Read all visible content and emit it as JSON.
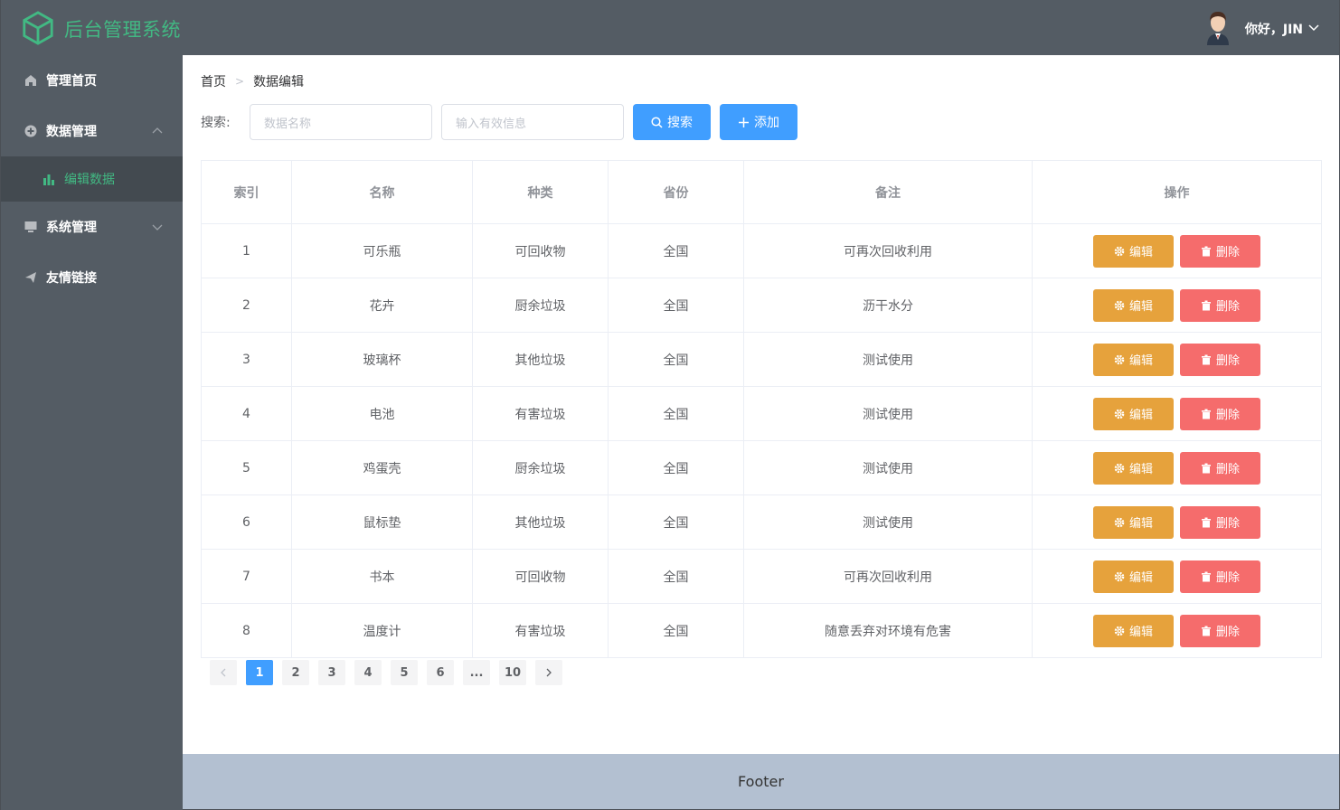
{
  "header": {
    "title": "后台管理系统",
    "greeting": "你好，JIN"
  },
  "sidebar": {
    "items": [
      {
        "label": "管理首页",
        "icon": "home-icon"
      },
      {
        "label": "数据管理",
        "icon": "circle-plus-icon",
        "expanded": true,
        "children": [
          {
            "label": "编辑数据",
            "icon": "bar-chart-icon",
            "active": true
          }
        ]
      },
      {
        "label": "系统管理",
        "icon": "monitor-icon",
        "expanded": false
      },
      {
        "label": "友情链接",
        "icon": "send-icon"
      }
    ]
  },
  "breadcrumb": [
    "首页",
    "数据编辑"
  ],
  "search": {
    "label": "搜索:",
    "name_placeholder": "数据名称",
    "info_placeholder": "输入有效信息",
    "search_button": "搜索",
    "add_button": "添加"
  },
  "table": {
    "columns": [
      "索引",
      "名称",
      "种类",
      "省份",
      "备注",
      "操作"
    ],
    "rows": [
      {
        "index": "1",
        "name": "可乐瓶",
        "kind": "可回收物",
        "province": "全国",
        "note": "可再次回收利用"
      },
      {
        "index": "2",
        "name": "花卉",
        "kind": "厨余垃圾",
        "province": "全国",
        "note": "沥干水分"
      },
      {
        "index": "3",
        "name": "玻璃杯",
        "kind": "其他垃圾",
        "province": "全国",
        "note": "测试使用"
      },
      {
        "index": "4",
        "name": "电池",
        "kind": "有害垃圾",
        "province": "全国",
        "note": "测试使用"
      },
      {
        "index": "5",
        "name": "鸡蛋壳",
        "kind": "厨余垃圾",
        "province": "全国",
        "note": "测试使用"
      },
      {
        "index": "6",
        "name": "鼠标垫",
        "kind": "其他垃圾",
        "province": "全国",
        "note": "测试使用"
      },
      {
        "index": "7",
        "name": "书本",
        "kind": "可回收物",
        "province": "全国",
        "note": "可再次回收利用"
      },
      {
        "index": "8",
        "name": "温度计",
        "kind": "有害垃圾",
        "province": "全国",
        "note": "随意丢弃对环境有危害"
      }
    ],
    "edit_label": "编辑",
    "delete_label": "删除"
  },
  "pagination": {
    "pages": [
      "1",
      "2",
      "3",
      "4",
      "5",
      "6",
      "...",
      "10"
    ],
    "current": "1"
  },
  "footer": {
    "text": "Footer"
  },
  "colors": {
    "accent": "#409eff",
    "brand": "#42b983",
    "warning": "#e6a23c",
    "danger": "#f56c6c",
    "sidebar": "#545c64"
  }
}
